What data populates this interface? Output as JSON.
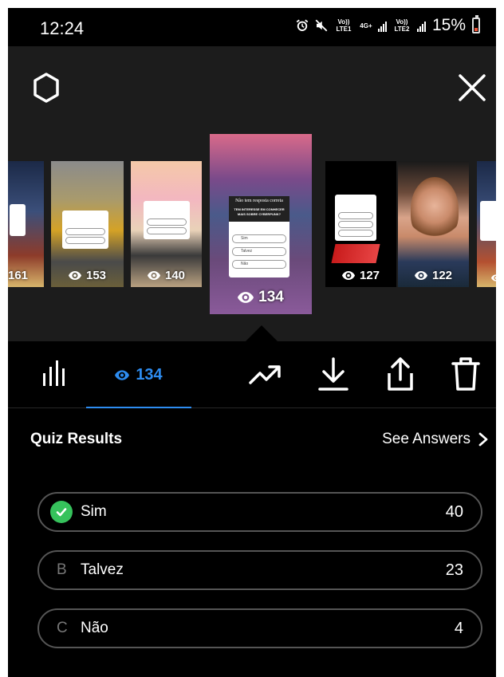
{
  "status_bar": {
    "time": "12:24",
    "network_1": "Vo)) LTE1",
    "network_type": "4G+",
    "network_2": "Vo)) LTE2",
    "battery_percent": "15%"
  },
  "stories": [
    {
      "views": "161"
    },
    {
      "views": "153"
    },
    {
      "views": "140"
    },
    {
      "views": "134",
      "selected": true,
      "quiz_title": "Não tem resposta correta",
      "quiz_question": "TEM INTERESSE EM CONHECER MAIS SOBRE CYBERPUNK?",
      "options": [
        "Sim",
        "Talvez",
        "Não"
      ]
    },
    {
      "views": "127"
    },
    {
      "views": "122"
    }
  ],
  "toolbar": {
    "viewers_count": "134"
  },
  "quiz_results": {
    "title": "Quiz Results",
    "see_answers": "See Answers",
    "options": [
      {
        "letter": "",
        "label": "Sim",
        "count": "40",
        "correct": true
      },
      {
        "letter": "B",
        "label": "Talvez",
        "count": "23",
        "correct": false
      },
      {
        "letter": "C",
        "label": "Não",
        "count": "4",
        "correct": false
      }
    ]
  },
  "colors": {
    "accent": "#2d8cf0",
    "correct": "#36c25c",
    "background": "#000000"
  }
}
